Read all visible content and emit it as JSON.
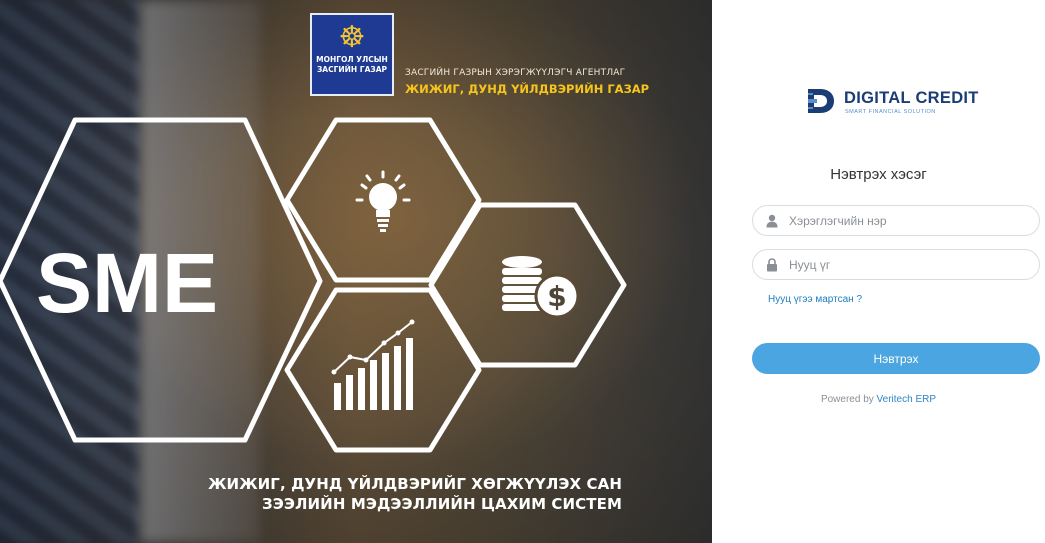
{
  "hero": {
    "emblem_line1": "МОНГОЛ УЛСЫН",
    "emblem_line2": "ЗАСГИЙН ГАЗАР",
    "agency_line1": "ЗАСГИЙН ГАЗРЫН ХЭРЭГЖҮҮЛЭГЧ АГЕНТЛАГ",
    "agency_line2": "ЖИЖИГ, ДУНД ҮЙЛДВЭРИЙН ГАЗАР",
    "sme_label": "SME",
    "caption_line1": "ЖИЖИГ, ДУНД ҮЙЛДВЭРИЙГ ХӨГЖҮҮЛЭХ САН",
    "caption_line2": "ЗЭЭЛИЙН МЭДЭЭЛЛИЙН ЦАХИМ СИСТЕМ",
    "icons": [
      "lightbulb-icon",
      "coins-dollar-icon",
      "growth-chart-icon"
    ]
  },
  "login": {
    "brand_name": "DIGITAL CREDIT",
    "brand_tagline": "SMART FINANCIAL SOLUTION",
    "title": "Нэвтрэх хэсэг",
    "username_placeholder": "Хэрэглэгчийн нэр",
    "password_placeholder": "Нууц үг",
    "forgot_link": "Нууц үгээ мартсан ?",
    "submit_label": "Нэвтрэх",
    "powered_prefix": "Powered by",
    "powered_link": "Veritech ERP"
  },
  "colors": {
    "accent": "#4aa5e0",
    "link": "#1e7fc3",
    "brand": "#1b3d73",
    "agency_yellow": "#f6c51c",
    "emblem_blue": "#1f3a93"
  }
}
